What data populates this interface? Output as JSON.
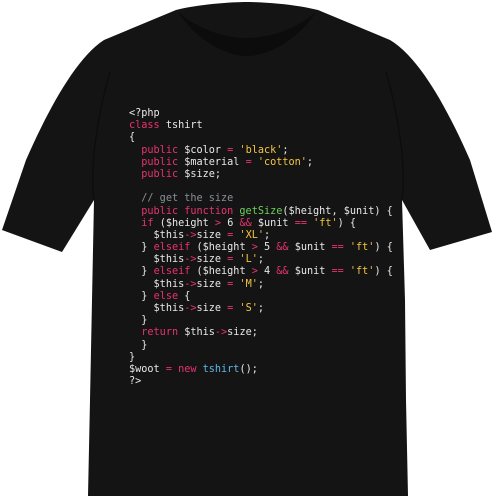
{
  "colors": {
    "shirt": "#141414",
    "shirt_shade": "#0c0c0c",
    "background": "#ffffff"
  },
  "code_lines": [
    {
      "indent": "",
      "tokens": [
        [
          "tag",
          "<?php"
        ]
      ]
    },
    {
      "indent": "",
      "tokens": [
        [
          "keyword",
          "class "
        ],
        [
          "plain",
          "tshirt"
        ]
      ]
    },
    {
      "indent": "",
      "tokens": [
        [
          "punct",
          "{"
        ]
      ]
    },
    {
      "indent": "  ",
      "tokens": [
        [
          "keyword",
          "public "
        ],
        [
          "variable",
          "$color "
        ],
        [
          "operator",
          "= "
        ],
        [
          "string",
          "'black'"
        ],
        [
          "punct",
          ";"
        ]
      ]
    },
    {
      "indent": "  ",
      "tokens": [
        [
          "keyword",
          "public "
        ],
        [
          "variable",
          "$material "
        ],
        [
          "operator",
          "= "
        ],
        [
          "string",
          "'cotton'"
        ],
        [
          "punct",
          ";"
        ]
      ]
    },
    {
      "indent": "  ",
      "tokens": [
        [
          "keyword",
          "public "
        ],
        [
          "variable",
          "$size"
        ],
        [
          "punct",
          ";"
        ]
      ]
    },
    {
      "indent": "",
      "tokens": [
        [
          "plain",
          ""
        ]
      ]
    },
    {
      "indent": "  ",
      "tokens": [
        [
          "comment",
          "// get the size"
        ]
      ]
    },
    {
      "indent": "  ",
      "tokens": [
        [
          "keyword",
          "public function "
        ],
        [
          "function",
          "getSize"
        ],
        [
          "punct",
          "("
        ],
        [
          "variable",
          "$height"
        ],
        [
          "punct",
          ", "
        ],
        [
          "variable",
          "$unit"
        ],
        [
          "punct",
          ") {"
        ]
      ]
    },
    {
      "indent": "  ",
      "tokens": [
        [
          "keyword",
          "if "
        ],
        [
          "punct",
          "("
        ],
        [
          "variable",
          "$height "
        ],
        [
          "operator",
          "> "
        ],
        [
          "number",
          "6 "
        ],
        [
          "operator",
          "&& "
        ],
        [
          "variable",
          "$unit "
        ],
        [
          "operator",
          "== "
        ],
        [
          "string",
          "'ft'"
        ],
        [
          "punct",
          ") {"
        ]
      ]
    },
    {
      "indent": "    ",
      "tokens": [
        [
          "variable",
          "$this"
        ],
        [
          "operator",
          "->"
        ],
        [
          "plain",
          "size "
        ],
        [
          "operator",
          "= "
        ],
        [
          "string",
          "'XL'"
        ],
        [
          "punct",
          ";"
        ]
      ]
    },
    {
      "indent": "  ",
      "tokens": [
        [
          "punct",
          "} "
        ],
        [
          "keyword",
          "elseif "
        ],
        [
          "punct",
          "("
        ],
        [
          "variable",
          "$height "
        ],
        [
          "operator",
          "> "
        ],
        [
          "number",
          "5 "
        ],
        [
          "operator",
          "&& "
        ],
        [
          "variable",
          "$unit "
        ],
        [
          "operator",
          "== "
        ],
        [
          "string",
          "'ft'"
        ],
        [
          "punct",
          ") {"
        ]
      ]
    },
    {
      "indent": "    ",
      "tokens": [
        [
          "variable",
          "$this"
        ],
        [
          "operator",
          "->"
        ],
        [
          "plain",
          "size "
        ],
        [
          "operator",
          "= "
        ],
        [
          "string",
          "'L'"
        ],
        [
          "punct",
          ";"
        ]
      ]
    },
    {
      "indent": "  ",
      "tokens": [
        [
          "punct",
          "} "
        ],
        [
          "keyword",
          "elseif "
        ],
        [
          "punct",
          "("
        ],
        [
          "variable",
          "$height "
        ],
        [
          "operator",
          "> "
        ],
        [
          "number",
          "4 "
        ],
        [
          "operator",
          "&& "
        ],
        [
          "variable",
          "$unit "
        ],
        [
          "operator",
          "== "
        ],
        [
          "string",
          "'ft'"
        ],
        [
          "punct",
          ") {"
        ]
      ]
    },
    {
      "indent": "    ",
      "tokens": [
        [
          "variable",
          "$this"
        ],
        [
          "operator",
          "->"
        ],
        [
          "plain",
          "size "
        ],
        [
          "operator",
          "= "
        ],
        [
          "string",
          "'M'"
        ],
        [
          "punct",
          ";"
        ]
      ]
    },
    {
      "indent": "  ",
      "tokens": [
        [
          "punct",
          "} "
        ],
        [
          "keyword",
          "else "
        ],
        [
          "punct",
          "{"
        ]
      ]
    },
    {
      "indent": "    ",
      "tokens": [
        [
          "variable",
          "$this"
        ],
        [
          "operator",
          "->"
        ],
        [
          "plain",
          "size "
        ],
        [
          "operator",
          "= "
        ],
        [
          "string",
          "'S'"
        ],
        [
          "punct",
          ";"
        ]
      ]
    },
    {
      "indent": "  ",
      "tokens": [
        [
          "punct",
          "}"
        ]
      ]
    },
    {
      "indent": "  ",
      "tokens": [
        [
          "keyword",
          "return "
        ],
        [
          "variable",
          "$this"
        ],
        [
          "operator",
          "->"
        ],
        [
          "plain",
          "size"
        ],
        [
          "punct",
          ";"
        ]
      ]
    },
    {
      "indent": "  ",
      "tokens": [
        [
          "punct",
          "}"
        ]
      ]
    },
    {
      "indent": "",
      "tokens": [
        [
          "punct",
          "}"
        ]
      ]
    },
    {
      "indent": "",
      "tokens": [
        [
          "variable",
          "$woot "
        ],
        [
          "operator",
          "= "
        ],
        [
          "keyword",
          "new "
        ],
        [
          "class",
          "tshirt"
        ],
        [
          "punct",
          "();"
        ]
      ]
    },
    {
      "indent": "",
      "tokens": [
        [
          "tag",
          "?>"
        ]
      ]
    }
  ]
}
